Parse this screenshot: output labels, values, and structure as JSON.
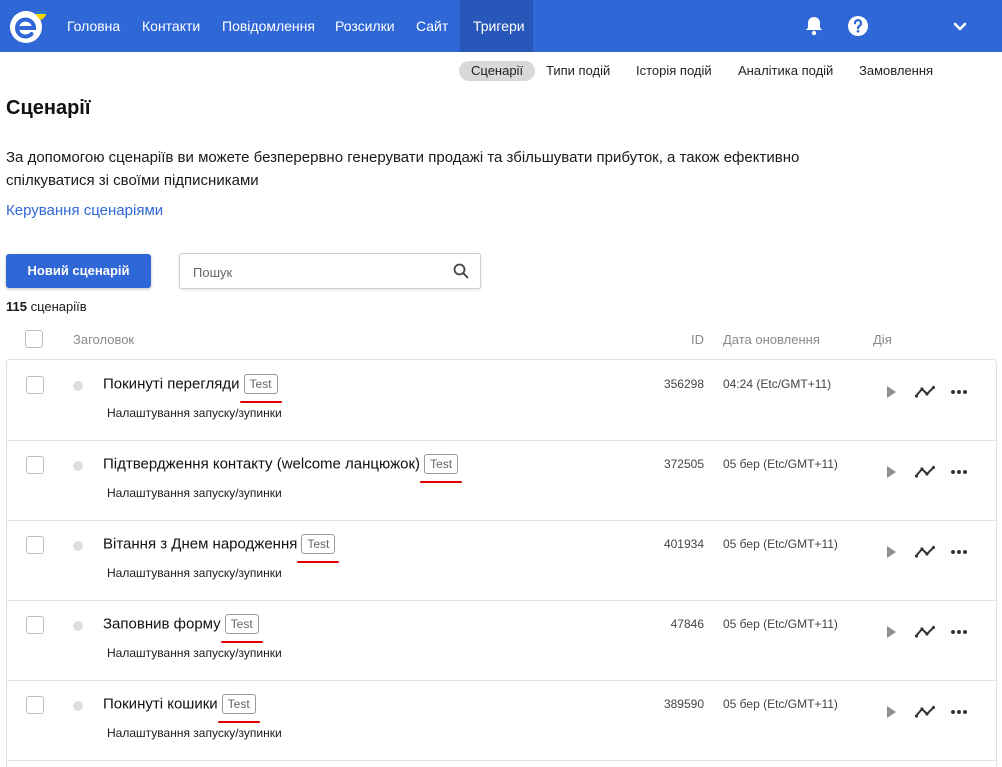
{
  "nav": {
    "items": [
      "Головна",
      "Контакти",
      "Повідомлення",
      "Розсилки",
      "Сайт",
      "Тригери"
    ],
    "active_index": 5
  },
  "icons": {
    "logo": "esputnik-logo",
    "notifications": "bell-icon",
    "help": "help-icon",
    "account_menu": "chevron-down-icon",
    "search": "search-icon",
    "play": "play-icon",
    "analytics": "analytics-icon",
    "more": "more-icon"
  },
  "colors": {
    "brand": "#2f67d6",
    "nav_active": "#2757b8",
    "highlight": "#e00000"
  },
  "subnav": {
    "items": [
      "Сценарії",
      "Типи подій",
      "Історія подій",
      "Аналітика подій",
      "Замовлення"
    ],
    "active_index": 0
  },
  "page": {
    "title": "Сценарії",
    "description": "За допомогою сценаріїв ви можете безперервно генерувати продажі та збільшувати прибуток, а також ефективно спілкуватися зі своїми підписниками",
    "manage_link": "Керування сценаріями",
    "new_button": "Новий сценарій",
    "search_placeholder": "Пошук",
    "count_number": "115",
    "count_label": " сценаріїв"
  },
  "table": {
    "headers": {
      "title": "Заголовок",
      "id": "ID",
      "date": "Дата оновлення",
      "action": "Дія"
    },
    "rows": [
      {
        "title": "Покинуті перегляди",
        "tag": "Test",
        "subtitle": "Налаштування запуску/зупинки",
        "id": "356298",
        "date": "04:24 (Etc/GMT+11)"
      },
      {
        "title": "Підтвердження контакту (welcome ланцюжок)",
        "tag": "Test",
        "subtitle": "Налаштування запуску/зупинки",
        "id": "372505",
        "date": "05 бер (Etc/GMT+11)"
      },
      {
        "title": "Вітання з Днем народження",
        "tag": "Test",
        "subtitle": "Налаштування запуску/зупинки",
        "id": "401934",
        "date": "05 бер (Etc/GMT+11)"
      },
      {
        "title": "Заповнив форму",
        "tag": "Test",
        "subtitle": "Налаштування запуску/зупинки",
        "id": "47846",
        "date": "05 бер (Etc/GMT+11)"
      },
      {
        "title": "Покинуті кошики",
        "tag": "Test",
        "subtitle": "Налаштування запуску/зупинки",
        "id": "389590",
        "date": "05 бер (Etc/GMT+11)"
      }
    ]
  }
}
